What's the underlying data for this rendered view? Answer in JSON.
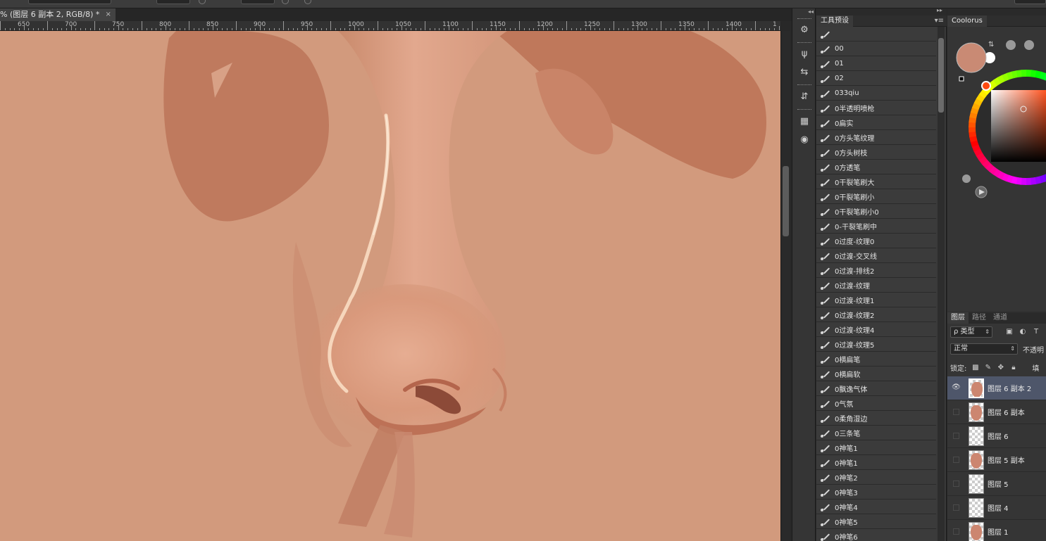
{
  "options_bar": {},
  "document": {
    "tab_title": "% (图层 6 副本 2, RGB/8) *",
    "close_symbol": "×"
  },
  "ruler": {
    "labels": [
      "650",
      "700",
      "750",
      "800",
      "850",
      "900",
      "950",
      "1000",
      "1050",
      "1100",
      "1150",
      "1200",
      "1250",
      "1300",
      "1350",
      "1400",
      "1"
    ]
  },
  "canvas": {
    "skin_base": "#d09678",
    "shadow": "#c07a5c",
    "highlight": "#f6d6bc"
  },
  "dock": {
    "icons": [
      "clone-source-icon",
      "brush-presets-icon",
      "adjustments-icon",
      "history-icon",
      "swatches-icon",
      "palette-icon"
    ]
  },
  "tool_presets": {
    "tab": "工具预设",
    "items": [
      "",
      "00",
      "01",
      "02",
      "033qiu",
      "0半透明喷枪",
      "0扁实",
      "0方头笔纹理",
      "0方头树枝",
      "0方透笔",
      "0干裂笔刷大",
      "0干裂笔刷小",
      "0干裂笔刷小0",
      "0-干裂笔刷中",
      "0过度-纹理0",
      "0过渡-交叉线",
      "0过渡-排线2",
      "0过渡-纹理",
      "0过渡-纹理1",
      "0过渡-纹理2",
      "0过渡-纹理4",
      "0过渡-纹理5",
      "0横扁笔",
      "0横扁软",
      "0飘逸气体",
      "0气氛",
      "0柔角湿边",
      "0三条笔",
      "0神笔1",
      "0神笔1",
      "0神笔2",
      "0神笔3",
      "0神笔4",
      "0神笔5",
      "0神笔6"
    ]
  },
  "coolorus": {
    "tab": "Coolorus",
    "current_color": "#c98a74"
  },
  "layers": {
    "tabs": [
      "图层",
      "路径",
      "通道"
    ],
    "filter_label": "ρ 类型",
    "blend_mode": "正常",
    "opacity_label": "不透明",
    "lock_label": "锁定:",
    "fill_label": "填",
    "items": [
      {
        "name": "图层 6 副本 2",
        "selected": true,
        "visible": true,
        "painted": true
      },
      {
        "name": "图层 6 副本",
        "selected": false,
        "visible": false,
        "painted": true
      },
      {
        "name": "图层 6",
        "selected": false,
        "visible": false,
        "painted": false
      },
      {
        "name": "图层 5 副本",
        "selected": false,
        "visible": false,
        "painted": true
      },
      {
        "name": "图层 5",
        "selected": false,
        "visible": false,
        "painted": false
      },
      {
        "name": "图层 4",
        "selected": false,
        "visible": false,
        "painted": false
      },
      {
        "name": "图层 1",
        "selected": false,
        "visible": false,
        "painted": true
      }
    ]
  }
}
